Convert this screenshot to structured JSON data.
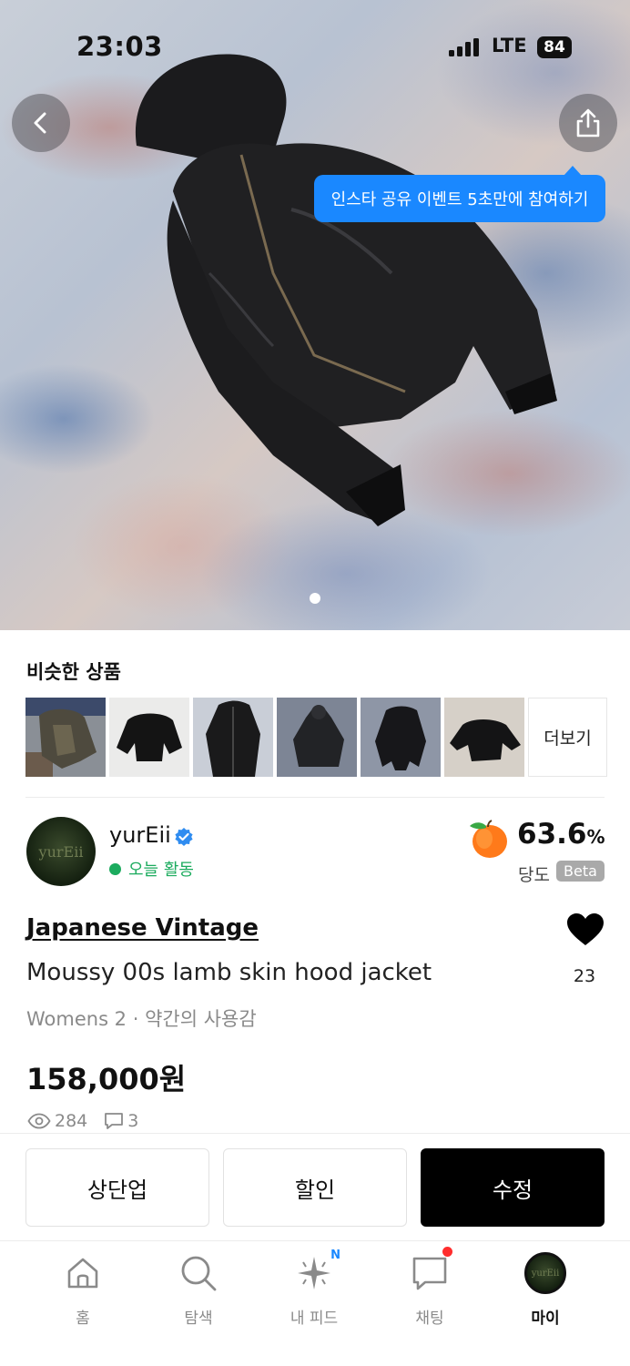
{
  "status_bar": {
    "time": "23:03",
    "network": "LTE",
    "battery": "84"
  },
  "hero": {
    "tooltip": "인스타 공유 이벤트 5초만에 참여하기",
    "image_count": 1,
    "active_index": 0
  },
  "similar": {
    "title": "비슷한 상품",
    "more_label": "더보기",
    "thumb_count": 6
  },
  "seller": {
    "name": "yurEii",
    "avatar_text": "yurEii",
    "activity": "오늘 활동",
    "sweetness_value": "63.6",
    "sweetness_unit": "%",
    "sweetness_label": "당도",
    "beta_label": "Beta"
  },
  "product": {
    "brand": "Japanese Vintage",
    "name": "Moussy 00s lamb skin hood jacket",
    "meta": "Womens 2 · 약간의 사용감",
    "price": "158,000원",
    "likes": "23",
    "views": "284",
    "comments": "3"
  },
  "actions": {
    "bump": "상단업",
    "discount": "할인",
    "edit": "수정"
  },
  "nav": {
    "items": [
      {
        "label": "홈",
        "icon": "home-icon"
      },
      {
        "label": "탐색",
        "icon": "search-icon"
      },
      {
        "label": "내 피드",
        "icon": "sparkle-icon",
        "badge": "N"
      },
      {
        "label": "채팅",
        "icon": "chat-icon"
      },
      {
        "label": "마이",
        "icon": "profile-avatar"
      }
    ],
    "active": "마이"
  },
  "colors": {
    "accent_blue": "#1a88ff",
    "active_green": "#1cab5e",
    "notification_red": "#ff2d2d"
  }
}
